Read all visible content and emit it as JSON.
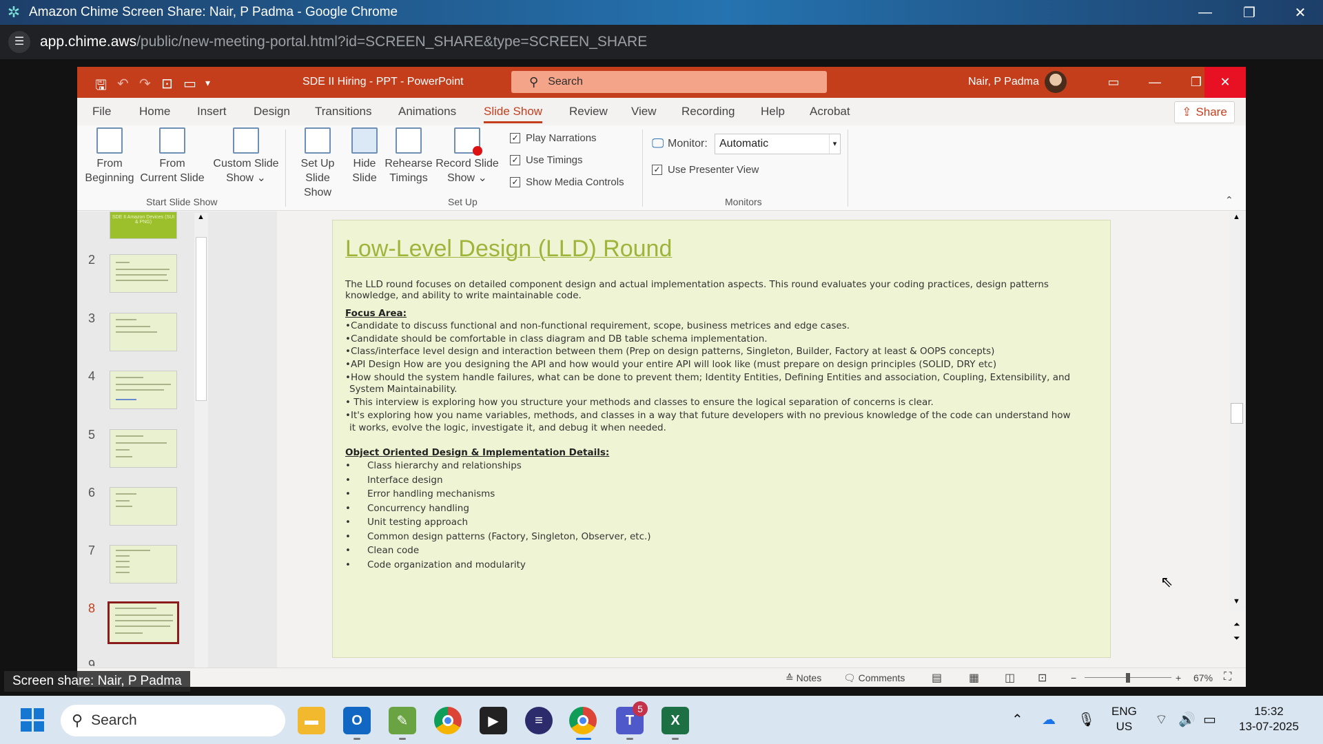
{
  "browser": {
    "window_title": "Amazon Chime Screen Share: Nair, P Padma - Google Chrome",
    "url_host": "app.chime.aws",
    "url_path": "/public/new-meeting-portal.html?id=SCREEN_SHARE&type=SCREEN_SHARE",
    "minimize_icon": "minimize-icon",
    "restore_icon": "restore-icon",
    "close_icon": "close-icon"
  },
  "screen_share_label": "Screen share: Nair, P Padma",
  "ppt": {
    "doc_title": "SDE II Hiring - PPT  -  PowerPoint",
    "search_placeholder": "Search",
    "user_name": "Nair, P Padma",
    "share_label": "Share",
    "tabs": [
      "File",
      "Home",
      "Insert",
      "Design",
      "Transitions",
      "Animations",
      "Slide Show",
      "Review",
      "View",
      "Recording",
      "Help",
      "Acrobat"
    ],
    "active_tab": "Slide Show",
    "ribbon": {
      "from_beginning": [
        "From",
        "Beginning"
      ],
      "from_current": [
        "From",
        "Current Slide"
      ],
      "custom_show": [
        "Custom Slide",
        "Show ⌄"
      ],
      "group_start": "Start Slide Show",
      "setup_show": [
        "Set Up",
        "Slide Show"
      ],
      "hide_slide": [
        "Hide",
        "Slide"
      ],
      "rehearse": [
        "Rehearse",
        "Timings"
      ],
      "record": [
        "Record Slide",
        "Show ⌄"
      ],
      "play_narrations": "Play Narrations",
      "use_timings": "Use Timings",
      "show_media": "Show Media Controls",
      "group_setup": "Set Up",
      "monitor_label": "Monitor:",
      "monitor_value": "Automatic",
      "presenter_view": "Use Presenter View",
      "group_monitors": "Monitors"
    },
    "thumb_numbers": [
      "2",
      "3",
      "4",
      "5",
      "6",
      "7",
      "8",
      "9"
    ],
    "selected_slide": "8",
    "first_thumb_text": "SDE II Amazon Devices (SUI & PNG)",
    "slide": {
      "title": "Low-Level Design (LLD) Round",
      "intro_1": "The LLD round focuses on detailed component design and actual implementation aspects. This round evaluates your coding practices, design patterns",
      "intro_2": "knowledge, and ability to write maintainable code.",
      "focus_heading": "Focus Area:",
      "focus_items": [
        "•Candidate to discuss functional and non-functional requirement, scope, business metrices and edge cases.",
        "•Candidate should be comfortable in class diagram and DB table schema implementation.",
        "•Class/interface level design and interaction between them (Prep on design patterns, Singleton, Builder, Factory at least & OOPS concepts)",
        "•API Design  How are you designing the API and how would your entire API will look like (must prepare on design principles (SOLID, DRY etc)",
        "•How should the system handle failures, what can be done to prevent them; Identity Entities, Defining Entities and association, Coupling, Extensibility, and",
        "  System Maintainability.",
        "• This interview is exploring how you structure your methods and classes to ensure the logical separation of concerns is clear.",
        "•It's exploring how you name variables, methods, and classes in a way that future developers with no previous knowledge of the code can understand how",
        "  it works, evolve the logic, investigate it, and debug it when needed."
      ],
      "ood_heading": "Object Oriented Design & Implementation Details:",
      "ood_items": [
        "Class hierarchy and relationships",
        "Interface design",
        "Error handling mechanisms",
        "Concurrency handling",
        "Unit testing approach",
        "Common design patterns (Factory, Singleton, Observer, etc.)",
        "Clean code",
        "Code organization and modularity"
      ]
    },
    "status": {
      "notes": "Notes",
      "comments": "Comments",
      "zoom": "67%"
    }
  },
  "taskbar": {
    "search_placeholder": "Search",
    "teams_badge": "5",
    "lang_1": "ENG",
    "lang_2": "US",
    "time": "15:32",
    "date": "13-07-2025"
  },
  "colors": {
    "ppt_accent": "#c43e1c",
    "slide_bg": "#eff5d4",
    "slide_title": "#9fb43a"
  }
}
